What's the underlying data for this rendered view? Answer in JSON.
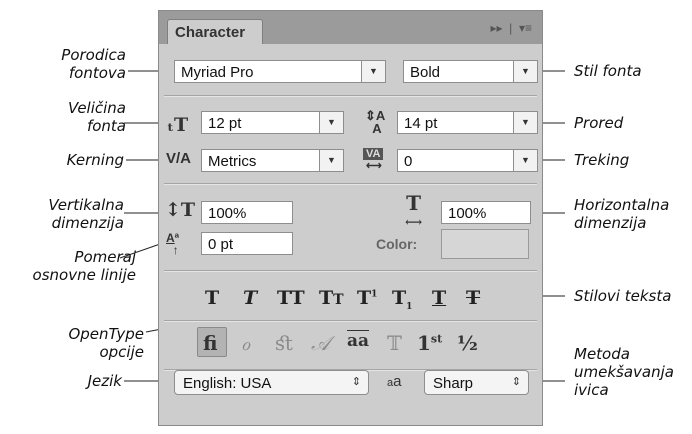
{
  "annotations": {
    "font_family": "Porodica\nfontova",
    "font_size": "Veličina\nfonta",
    "kerning": "Kerning",
    "vertical_scale": "Vertikalna\ndimenzija",
    "baseline_shift": "Pomeraj\nosnovne linije",
    "opentype": "OpenType\nopcije",
    "language": "Jezik",
    "font_style": "Stil fonta",
    "leading": "Prored",
    "tracking": "Treking",
    "horizontal_scale": "Horizontalna\ndimenzija",
    "text_styles": "Stilovi teksta",
    "antialias": "Metoda\numekšavanja\nivica"
  },
  "panel": {
    "tab_title": "Character",
    "font_family": "Myriad Pro",
    "font_style": "Bold",
    "font_size": "12 pt",
    "leading": "14 pt",
    "kerning": "Metrics",
    "tracking": "0",
    "vertical_scale": "100%",
    "horizontal_scale": "100%",
    "baseline_shift": "0 pt",
    "color_label": "Color:",
    "language": "English: USA",
    "antialias": "Sharp",
    "text_style_icons": [
      "faux-bold-icon",
      "faux-italic-icon",
      "all-caps-icon",
      "small-caps-icon",
      "superscript-icon",
      "subscript-icon",
      "underline-icon",
      "strikethrough-icon"
    ],
    "opentype_icons": [
      "ligature-icon",
      "discretionary-ligature-icon",
      "swash-icon",
      "stylistic-alternates-icon",
      "titling-alternates-icon",
      "ordinals-icon",
      "fractions-icon"
    ],
    "colors": {
      "panel_bg": "#cdcdcd",
      "titlebar_bg": "#9b9b9b",
      "color_swatch": "#d6d6d6"
    }
  }
}
